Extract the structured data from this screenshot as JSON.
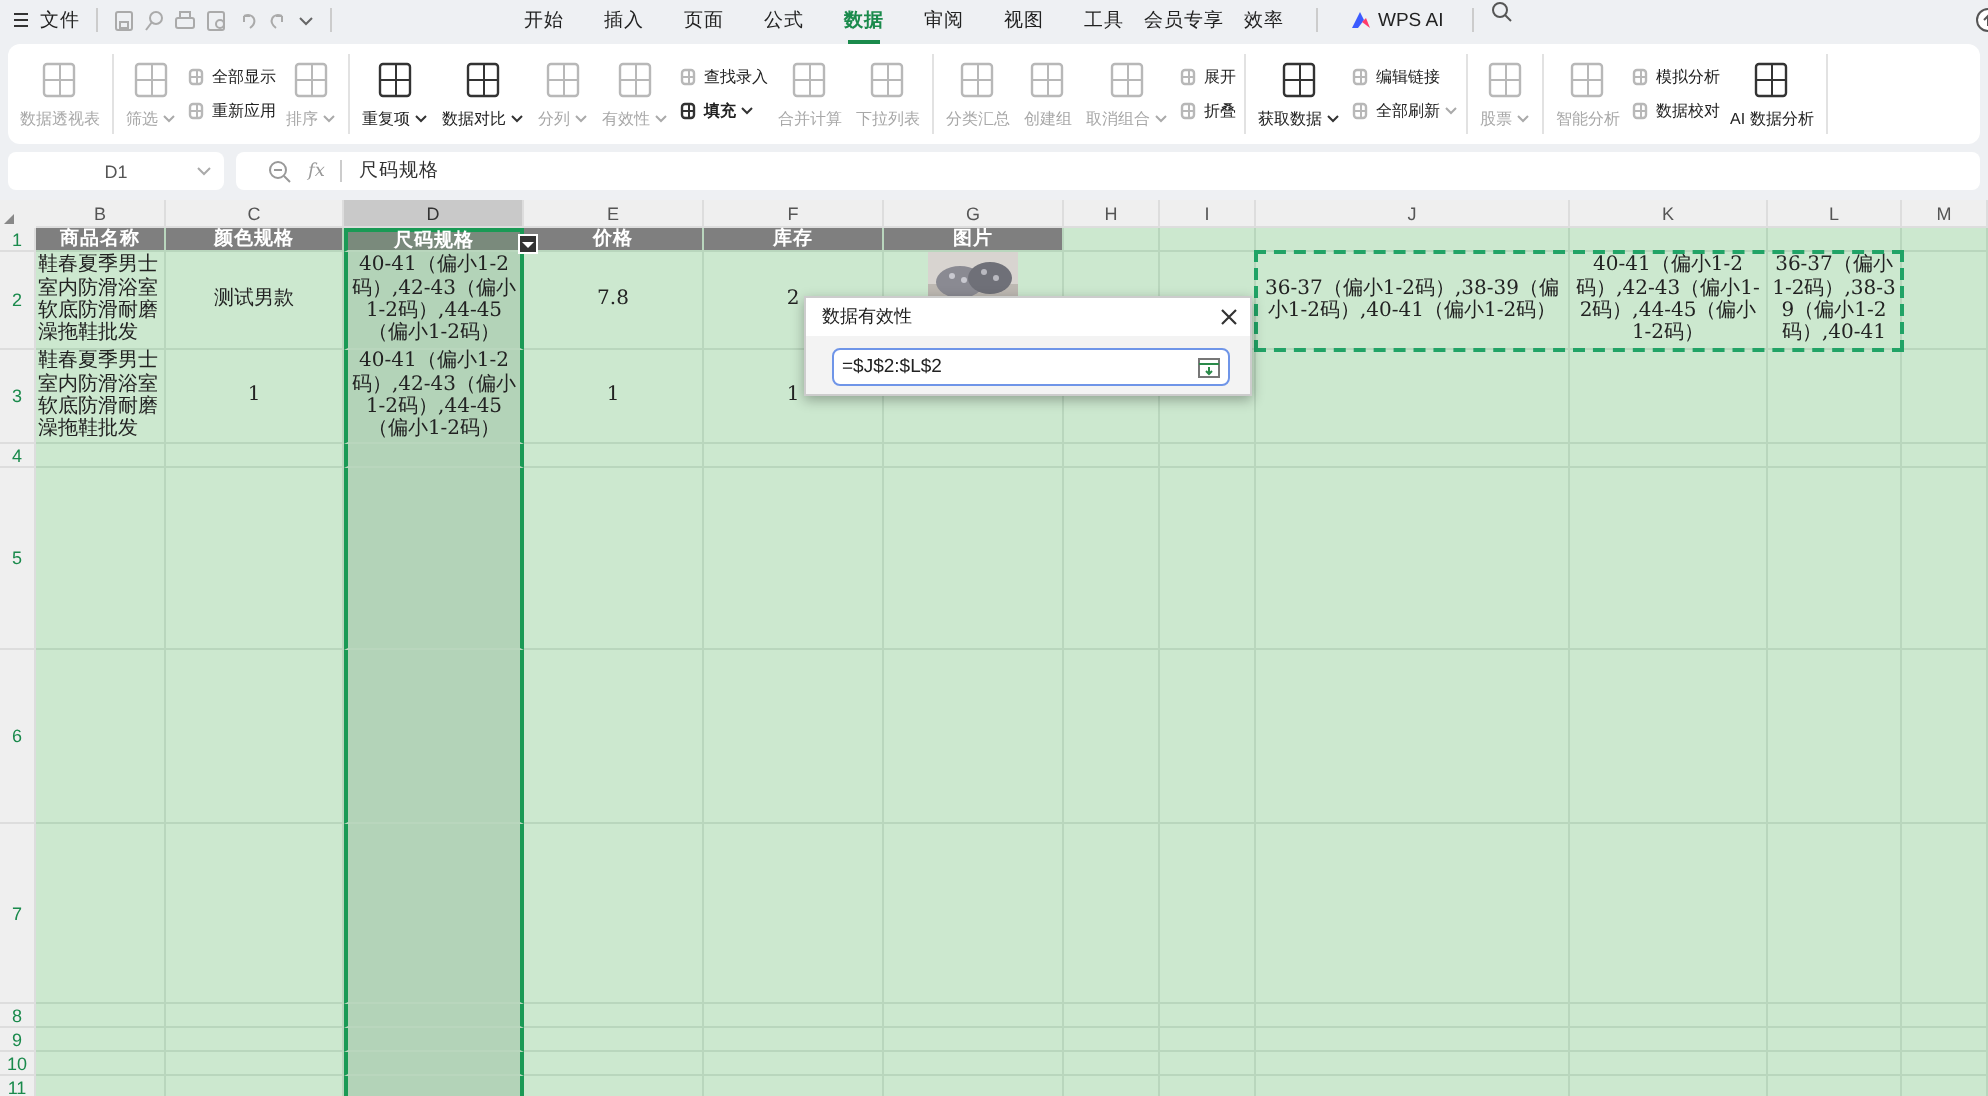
{
  "menubar": {
    "file": "文件",
    "tabs": [
      {
        "label": "开始",
        "selected": false
      },
      {
        "label": "插入",
        "selected": false
      },
      {
        "label": "页面",
        "selected": false
      },
      {
        "label": "公式",
        "selected": false
      },
      {
        "label": "数据",
        "selected": true
      },
      {
        "label": "审阅",
        "selected": false
      },
      {
        "label": "视图",
        "selected": false
      },
      {
        "label": "工具",
        "selected": false
      },
      {
        "label": "会员专享",
        "selected": false
      },
      {
        "label": "效率",
        "selected": false
      }
    ],
    "ai": "WPS AI"
  },
  "ribbon": {
    "groups": [
      {
        "items": [
          {
            "kind": "big",
            "label": "数据透视表",
            "disabled": true,
            "dropdown": false
          }
        ]
      },
      {
        "items": [
          {
            "kind": "big",
            "label": "筛选",
            "disabled": true,
            "dropdown": true
          },
          {
            "kind": "stack",
            "items": [
              {
                "label": "全部显示",
                "disabled": true,
                "dropdown": false
              },
              {
                "label": "重新应用",
                "disabled": true,
                "dropdown": false
              }
            ]
          },
          {
            "kind": "big",
            "label": "排序",
            "disabled": true,
            "dropdown": true
          }
        ]
      },
      {
        "items": [
          {
            "kind": "big",
            "label": "重复项",
            "disabled": false,
            "dropdown": true
          },
          {
            "kind": "big",
            "label": "数据对比",
            "disabled": false,
            "dropdown": true
          },
          {
            "kind": "big",
            "label": "分列",
            "disabled": true,
            "dropdown": true
          },
          {
            "kind": "big",
            "label": "有效性",
            "disabled": true,
            "dropdown": true
          },
          {
            "kind": "stack",
            "items": [
              {
                "label": "查找录入",
                "disabled": true,
                "dropdown": false
              },
              {
                "label": "填充",
                "disabled": false,
                "dropdown": true
              }
            ]
          },
          {
            "kind": "big",
            "label": "合并计算",
            "disabled": true,
            "dropdown": false
          },
          {
            "kind": "big",
            "label": "下拉列表",
            "disabled": true,
            "dropdown": false
          }
        ]
      },
      {
        "items": [
          {
            "kind": "big",
            "label": "分类汇总",
            "disabled": true,
            "dropdown": false
          },
          {
            "kind": "big",
            "label": "创建组",
            "disabled": true,
            "dropdown": false
          },
          {
            "kind": "big",
            "label": "取消组合",
            "disabled": true,
            "dropdown": true
          },
          {
            "kind": "stack",
            "items": [
              {
                "label": "展开",
                "disabled": true,
                "dropdown": false
              },
              {
                "label": "折叠",
                "disabled": true,
                "dropdown": false
              }
            ]
          }
        ]
      },
      {
        "items": [
          {
            "kind": "big",
            "label": "获取数据",
            "disabled": false,
            "dropdown": true
          },
          {
            "kind": "stack",
            "items": [
              {
                "label": "编辑链接",
                "disabled": true,
                "dropdown": false
              },
              {
                "label": "全部刷新",
                "disabled": true,
                "dropdown": true
              }
            ]
          }
        ]
      },
      {
        "items": [
          {
            "kind": "big",
            "label": "股票",
            "disabled": true,
            "dropdown": true
          }
        ]
      },
      {
        "items": [
          {
            "kind": "big",
            "label": "智能分析",
            "disabled": true,
            "dropdown": false
          },
          {
            "kind": "stack",
            "items": [
              {
                "label": "模拟分析",
                "disabled": true,
                "dropdown": false
              },
              {
                "label": "数据校对",
                "disabled": true,
                "dropdown": false
              }
            ]
          },
          {
            "kind": "big",
            "label": "AI 数据分析",
            "disabled": false,
            "dropdown": false
          }
        ]
      }
    ]
  },
  "formula_bar": {
    "cell": "D1",
    "fx": "fx",
    "formula": "尺码规格"
  },
  "sheet": {
    "columns": [
      {
        "label": "B",
        "selected": false
      },
      {
        "label": "C",
        "selected": false
      },
      {
        "label": "D",
        "selected": true
      },
      {
        "label": "E",
        "selected": false
      },
      {
        "label": "F",
        "selected": false
      },
      {
        "label": "G",
        "selected": false
      },
      {
        "label": "H",
        "selected": false
      },
      {
        "label": "I",
        "selected": false
      },
      {
        "label": "J",
        "selected": false
      },
      {
        "label": "K",
        "selected": false
      },
      {
        "label": "L",
        "selected": false
      },
      {
        "label": "M",
        "selected": false
      }
    ],
    "rows": [
      {
        "label": "1",
        "kind": "header",
        "cells": [
          {
            "text": "商品名称"
          },
          {
            "text": "颜色规格"
          },
          {
            "text": "尺码规格",
            "filter": true
          },
          {
            "text": "价格"
          },
          {
            "text": "库存"
          },
          {
            "text": "图片"
          },
          null,
          null,
          null,
          null,
          null,
          null
        ]
      },
      {
        "label": "2",
        "kind": "data",
        "cells": [
          {
            "text": "鞋春夏季男士室内防滑浴室软底防滑耐磨澡拖鞋批发",
            "kind": "left"
          },
          {
            "text": "测试男款"
          },
          {
            "text": "40-41（偏小1-2码）,42-43（偏小1-2码）,44-45（偏小1-2码）"
          },
          {
            "text": "7.8"
          },
          {
            "text": "2"
          },
          {
            "kind": "picture"
          },
          null,
          null,
          {
            "text": "36-37（偏小1-2码）,38-39（偏小1-2码）,40-41（偏小1-2码）"
          },
          {
            "text": "40-41（偏小1-2码）,42-43（偏小1-2码）,44-45（偏小1-2码）"
          },
          {
            "text": "36-37（偏小1-2码）,38-39（偏小1-2码）,40-41"
          },
          null
        ]
      },
      {
        "label": "3",
        "kind": "data",
        "cells": [
          {
            "text": "鞋春夏季男士室内防滑浴室软底防滑耐磨澡拖鞋批发",
            "kind": "left"
          },
          {
            "text": "1"
          },
          {
            "text": "40-41（偏小1-2码）,42-43（偏小1-2码）,44-45（偏小1-2码）"
          },
          {
            "text": "1"
          },
          {
            "text": "1"
          },
          null,
          null,
          null,
          null,
          null,
          null,
          null
        ]
      },
      {
        "label": "4",
        "kind": "data",
        "cells": []
      },
      {
        "label": "5",
        "kind": "data",
        "cells": []
      },
      {
        "label": "6",
        "kind": "data",
        "cells": []
      },
      {
        "label": "7",
        "kind": "data",
        "cells": []
      },
      {
        "label": "8",
        "kind": "data",
        "cells": []
      },
      {
        "label": "9",
        "kind": "data",
        "cells": []
      },
      {
        "label": "10",
        "kind": "data",
        "cells": []
      },
      {
        "label": "11",
        "kind": "data",
        "cells": []
      }
    ],
    "copy_marquee": true
  },
  "dialog": {
    "title": "数据有效性",
    "value": "=$J$2:$L$2"
  }
}
